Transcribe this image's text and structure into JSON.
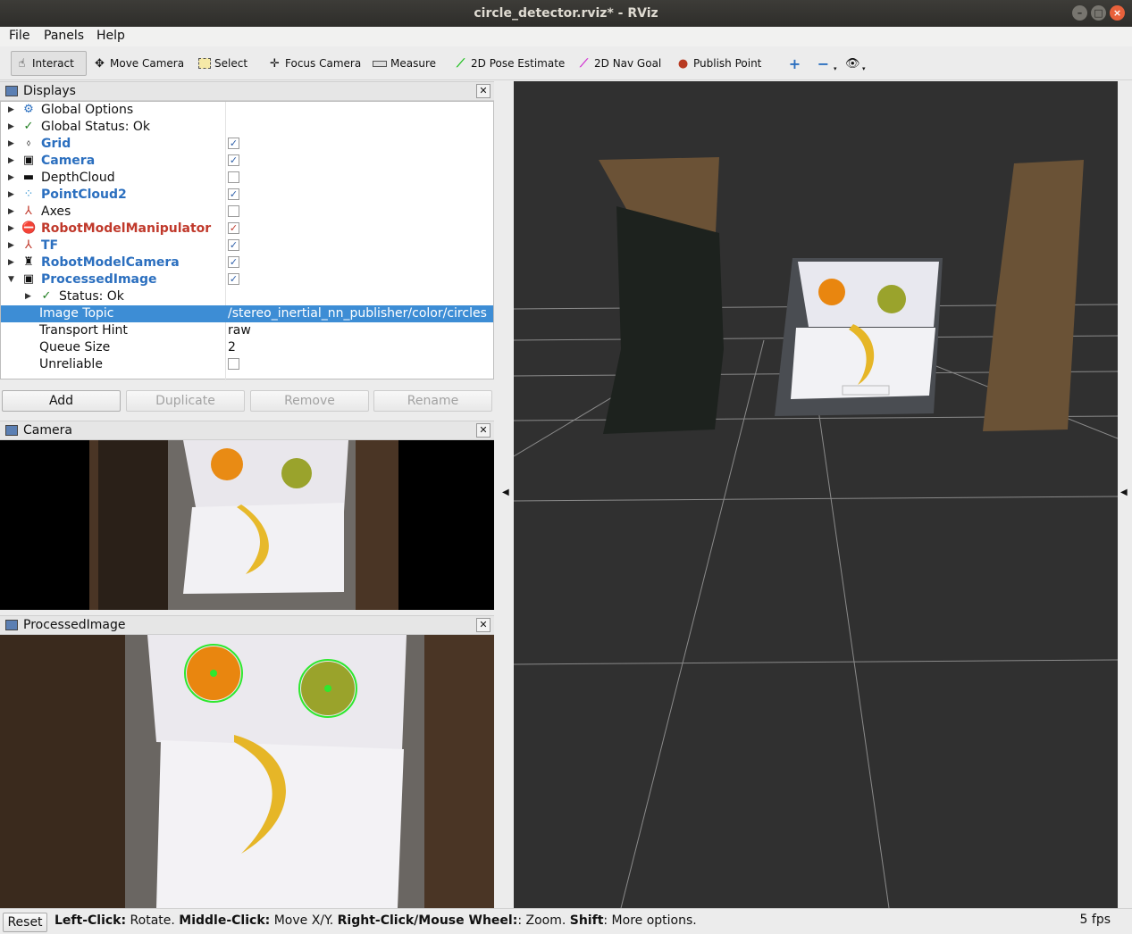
{
  "window": {
    "title": "circle_detector.rviz* - RViz"
  },
  "menu": [
    "File",
    "Panels",
    "Help"
  ],
  "toolbar": {
    "interact": "Interact",
    "move_camera": "Move Camera",
    "select": "Select",
    "focus_camera": "Focus Camera",
    "measure": "Measure",
    "pose_estimate": "2D Pose Estimate",
    "nav_goal": "2D Nav Goal",
    "publish_point": "Publish Point"
  },
  "displays": {
    "title": "Displays",
    "rows": [
      {
        "label": "Global Options"
      },
      {
        "label": "Global Status: Ok"
      },
      {
        "label": "Grid",
        "checked": true
      },
      {
        "label": "Camera",
        "checked": true
      },
      {
        "label": "DepthCloud",
        "checked": false
      },
      {
        "label": "PointCloud2",
        "checked": true
      },
      {
        "label": "Axes",
        "checked": false
      },
      {
        "label": "RobotModelManipulator",
        "checked": true
      },
      {
        "label": "TF",
        "checked": true
      },
      {
        "label": "RobotModelCamera",
        "checked": true
      },
      {
        "label": "ProcessedImage",
        "checked": true
      },
      {
        "label": "Status: Ok"
      },
      {
        "label": "Image Topic",
        "value": "/stereo_inertial_nn_publisher/color/circles"
      },
      {
        "label": "Transport Hint",
        "value": "raw"
      },
      {
        "label": "Queue Size",
        "value": "2"
      },
      {
        "label": "Unreliable",
        "checked": false
      }
    ],
    "buttons": {
      "add": "Add",
      "duplicate": "Duplicate",
      "remove": "Remove",
      "rename": "Rename"
    }
  },
  "camera_panel": {
    "title": "Camera"
  },
  "processed_panel": {
    "title": "ProcessedImage"
  },
  "status": {
    "reset": "Reset",
    "left_click_key": "Left-Click:",
    "left_click_val": " Rotate. ",
    "middle_click_key": "Middle-Click:",
    "middle_click_val": " Move X/Y. ",
    "right_click_key": "Right-Click/Mouse Wheel:",
    "right_click_val": ": Zoom. ",
    "shift_key": "Shift",
    "shift_val": ": More options.",
    "fps": "5 fps"
  }
}
